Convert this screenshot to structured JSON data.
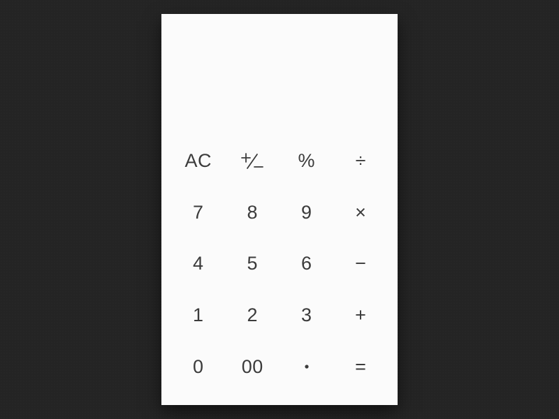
{
  "display": {
    "value": ""
  },
  "keys": {
    "ac": "AC",
    "sign": "+/−",
    "percent": "%",
    "divide": "÷",
    "seven": "7",
    "eight": "8",
    "nine": "9",
    "multiply": "×",
    "four": "4",
    "five": "5",
    "six": "6",
    "minus": "−",
    "one": "1",
    "two": "2",
    "three": "3",
    "plus": "+",
    "zero": "0",
    "doublezero": "00",
    "decimal": ".",
    "equals": "="
  }
}
